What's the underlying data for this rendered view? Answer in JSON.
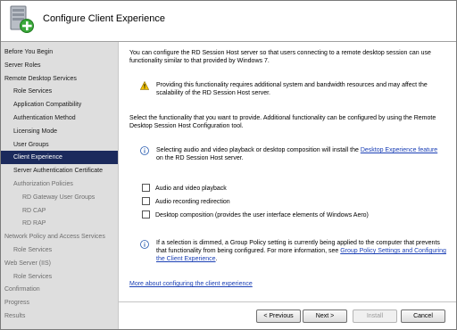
{
  "header": {
    "title": "Configure Client Experience",
    "icon_name": "server-add-icon"
  },
  "sidebar": {
    "items": [
      {
        "label": "Before You Begin",
        "level": 0,
        "state": "normal"
      },
      {
        "label": "Server Roles",
        "level": 0,
        "state": "normal"
      },
      {
        "label": "Remote Desktop Services",
        "level": 0,
        "state": "normal"
      },
      {
        "label": "Role Services",
        "level": 1,
        "state": "normal"
      },
      {
        "label": "Application Compatibility",
        "level": 1,
        "state": "normal"
      },
      {
        "label": "Authentication Method",
        "level": 1,
        "state": "normal"
      },
      {
        "label": "Licensing Mode",
        "level": 1,
        "state": "normal"
      },
      {
        "label": "User Groups",
        "level": 1,
        "state": "normal"
      },
      {
        "label": "Client Experience",
        "level": 1,
        "state": "selected"
      },
      {
        "label": "Server Authentication Certificate",
        "level": 1,
        "state": "normal"
      },
      {
        "label": "Authorization Policies",
        "level": 1,
        "state": "dim"
      },
      {
        "label": "RD Gateway User Groups",
        "level": 2,
        "state": "dim"
      },
      {
        "label": "RD CAP",
        "level": 2,
        "state": "dim"
      },
      {
        "label": "RD RAP",
        "level": 2,
        "state": "dim"
      },
      {
        "label": "Network Policy and Access Services",
        "level": 0,
        "state": "dim"
      },
      {
        "label": "Role Services",
        "level": 1,
        "state": "dim"
      },
      {
        "label": "Web Server (IIS)",
        "level": 0,
        "state": "dim"
      },
      {
        "label": "Role Services",
        "level": 1,
        "state": "dim"
      },
      {
        "label": "Confirmation",
        "level": 0,
        "state": "dim"
      },
      {
        "label": "Progress",
        "level": 0,
        "state": "dim"
      },
      {
        "label": "Results",
        "level": 0,
        "state": "dim"
      }
    ]
  },
  "main": {
    "intro": "You can configure the RD Session Host server so that users connecting to a remote desktop session can use functionality similar to that provided by Windows 7.",
    "warning": "Providing this functionality requires additional system and bandwidth resources and may affect the scalability of the RD Session Host server.",
    "select_text": "Select the functionality that you want to provide. Additional functionality can be configured by using the Remote Desktop Session Host Configuration tool.",
    "info1_before": "Selecting audio and video playback or desktop composition will install the ",
    "info1_link": "Desktop Experience feature",
    "info1_after": " on the RD Session Host server.",
    "checkboxes": [
      {
        "label": "Audio and video playback",
        "checked": false
      },
      {
        "label": "Audio recording redirection",
        "checked": false
      },
      {
        "label": "Desktop composition (provides the user interface elements of Windows Aero)",
        "checked": false
      }
    ],
    "info2_before": "If a selection is dimmed, a Group Policy setting is currently being applied to the computer that prevents that functionality from being configured. For more information, see ",
    "info2_link": "Group Policy Settings and Configuring the Client Experience",
    "info2_after": ".",
    "more_link": "More about configuring the client experience"
  },
  "buttons": {
    "previous": "< Previous",
    "next": "Next >",
    "install": "Install",
    "cancel": "Cancel"
  },
  "colors": {
    "selected_nav_bg": "#1b2a5c",
    "link": "#1a3fb5",
    "warning": "#f2c200",
    "info": "#2a5db0"
  }
}
